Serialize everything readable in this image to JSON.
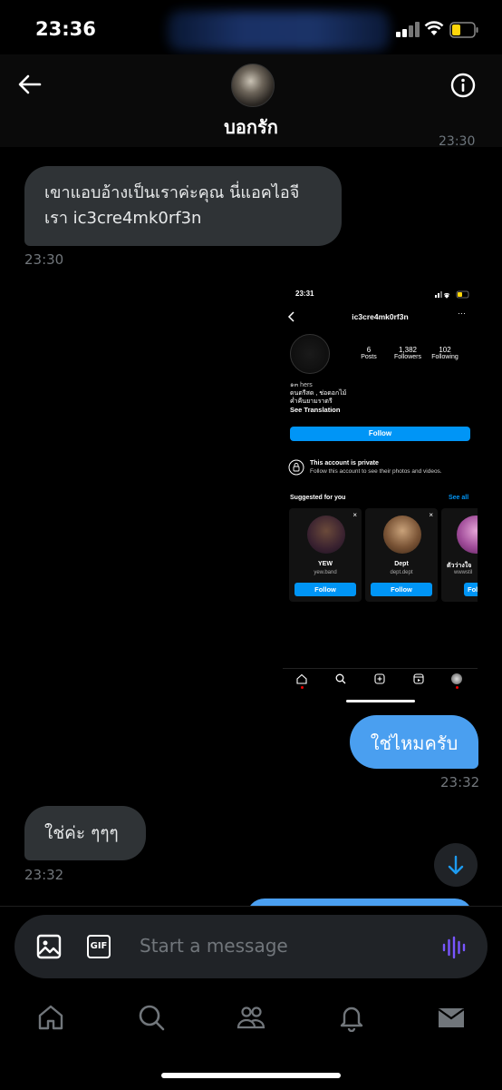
{
  "status_bar": {
    "time": "23:36"
  },
  "header": {
    "contact_name": "บอกรัก"
  },
  "messages": {
    "cut_timestamp": "23:30",
    "incoming1": {
      "text": "เขาแอบอ้างเป็นเราค่ะคุณ นี่แอคไอจีเรา ic3cre4mk0rf3n",
      "time": "23:30"
    },
    "outgoing1": {
      "text": "ใช่ไหมครับ",
      "time": "23:32"
    },
    "incoming2": {
      "text": "ใช่ค่ะ ๆๆๆ",
      "time": "23:32"
    }
  },
  "ig_screenshot": {
    "time": "23:31",
    "username": "ic3cre4mk0rf3n",
    "stats": [
      {
        "value": "6",
        "label": "Posts"
      },
      {
        "value": "1,382",
        "label": "Followers"
      },
      {
        "value": "102",
        "label": "Following"
      }
    ],
    "bio_line1": "๑๓ hers",
    "bio_line2": "ดนตรีสด , ช่อดอกไม้",
    "bio_line3": "ค่ำคืนยามราตรี",
    "see_translation": "See Translation",
    "follow_label": "Follow",
    "private_title": "This account is private",
    "private_subtitle": "Follow this account to see their photos and videos.",
    "suggested_title": "Suggested for you",
    "see_all": "See all",
    "suggestions": [
      {
        "name": "YEW",
        "handle": "yew.band",
        "button": "Follow"
      },
      {
        "name": "Dept",
        "handle": "dept.dept",
        "button": "Follow"
      },
      {
        "name": "ตัวว่างใจ",
        "handle": "wwwstil",
        "button": "Foll"
      }
    ]
  },
  "composer": {
    "placeholder": "Start a message",
    "gif_label": "GIF"
  },
  "colors": {
    "bubble_in": "#2f3336",
    "bubble_out": "#4a9ff0",
    "ig_blue": "#0095f6",
    "voice_purple": "#7856ff"
  }
}
